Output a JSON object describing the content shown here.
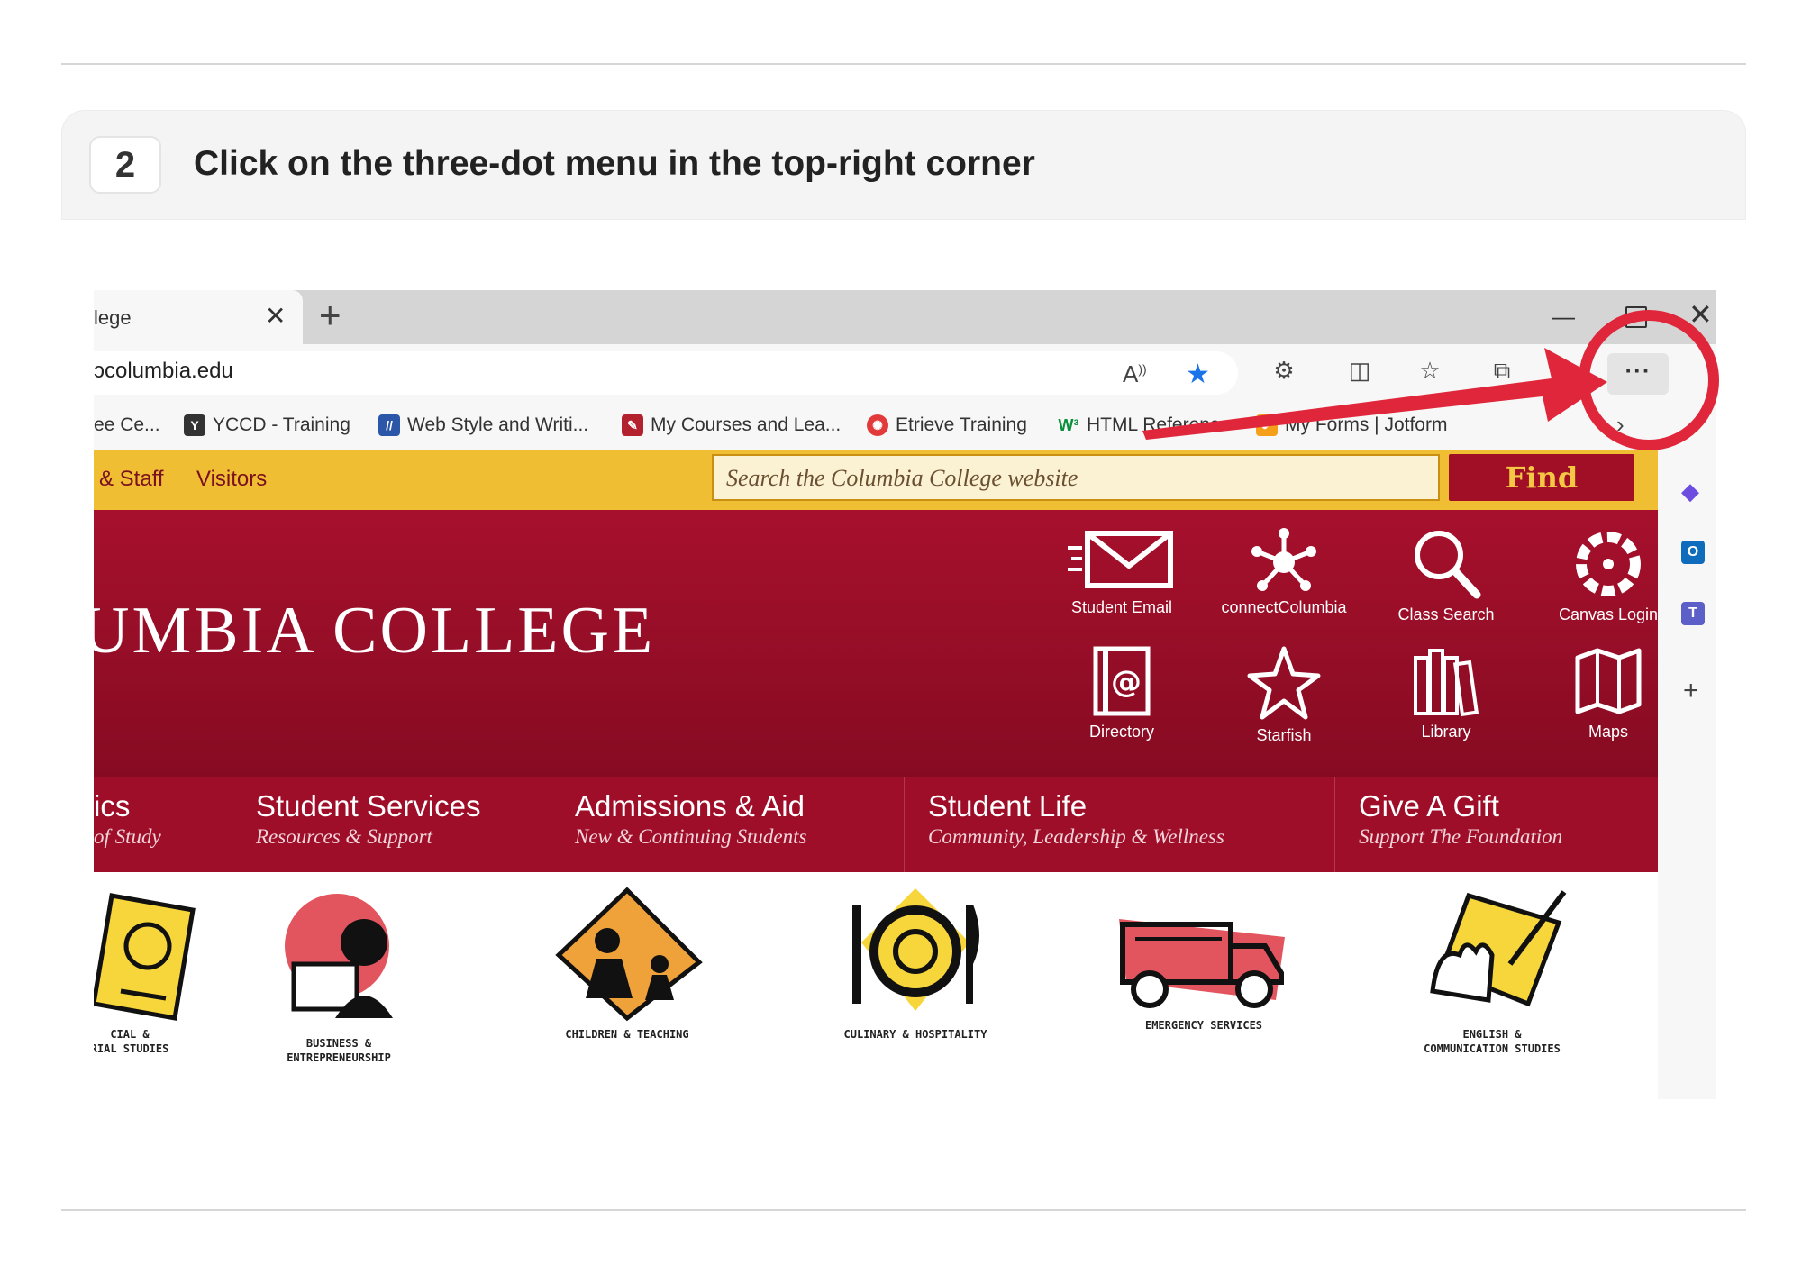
{
  "step": {
    "number": "2",
    "instruction": "Click on the three-dot menu in the top-right corner"
  },
  "browser": {
    "tab_title": "lege",
    "url": "ɔcolumbia.edu",
    "menu_button_label": "···",
    "bookmarks": [
      {
        "label": "ee Ce...",
        "icon": "bookmark-icon"
      },
      {
        "label": "YCCD - Training",
        "icon": "yccd-logo-icon"
      },
      {
        "label": "Web Style and Writi...",
        "icon": "web-style-icon"
      },
      {
        "label": "My Courses and Lea...",
        "icon": "courses-icon"
      },
      {
        "label": "Etrieve Training",
        "icon": "etrieve-icon"
      },
      {
        "label": "HTML Reference",
        "icon": "w3-icon"
      },
      {
        "label": "My Forms | Jotform",
        "icon": "jotform-icon"
      }
    ],
    "accent_color": "#1a73e8",
    "annotation_color": "#e0263a"
  },
  "site": {
    "nav": [
      "& Staff",
      "Visitors"
    ],
    "search_placeholder": "Search the Columbia College website",
    "find_label": "Find",
    "college_name": "UMBIA COLLEGE",
    "quick_links": [
      {
        "label": "Student Email",
        "icon": "envelope-icon"
      },
      {
        "label": "connectColumbia",
        "icon": "network-icon"
      },
      {
        "label": "Class Search",
        "icon": "magnifier-icon"
      },
      {
        "label": "Canvas Login",
        "icon": "canvas-icon"
      },
      {
        "label": "Directory",
        "icon": "address-book-icon"
      },
      {
        "label": "Starfish",
        "icon": "starfish-icon"
      },
      {
        "label": "Library",
        "icon": "books-icon"
      },
      {
        "label": "Maps",
        "icon": "map-icon"
      }
    ],
    "menu": [
      {
        "title": "ics",
        "subtitle": "of Study"
      },
      {
        "title": "Student Services",
        "subtitle": "Resources & Support"
      },
      {
        "title": "Admissions & Aid",
        "subtitle": "New & Continuing Students"
      },
      {
        "title": "Student Life",
        "subtitle": "Community, Leadership & Wellness"
      },
      {
        "title": "Give A Gift",
        "subtitle": "Support The Foundation"
      }
    ],
    "programs": [
      {
        "line1": "CIAL &",
        "line2": "RIAL STUDIES"
      },
      {
        "line1": "BUSINESS &",
        "line2": "ENTREPRENEURSHIP"
      },
      {
        "line1": "CHILDREN & TEACHING",
        "line2": ""
      },
      {
        "line1": "CULINARY & HOSPITALITY",
        "line2": ""
      },
      {
        "line1": "EMERGENCY SERVICES",
        "line2": ""
      },
      {
        "line1": "ENGLISH &",
        "line2": "COMMUNICATION STUDIES"
      }
    ],
    "brand_red": "#a00f26",
    "brand_gold": "#f0be32"
  }
}
